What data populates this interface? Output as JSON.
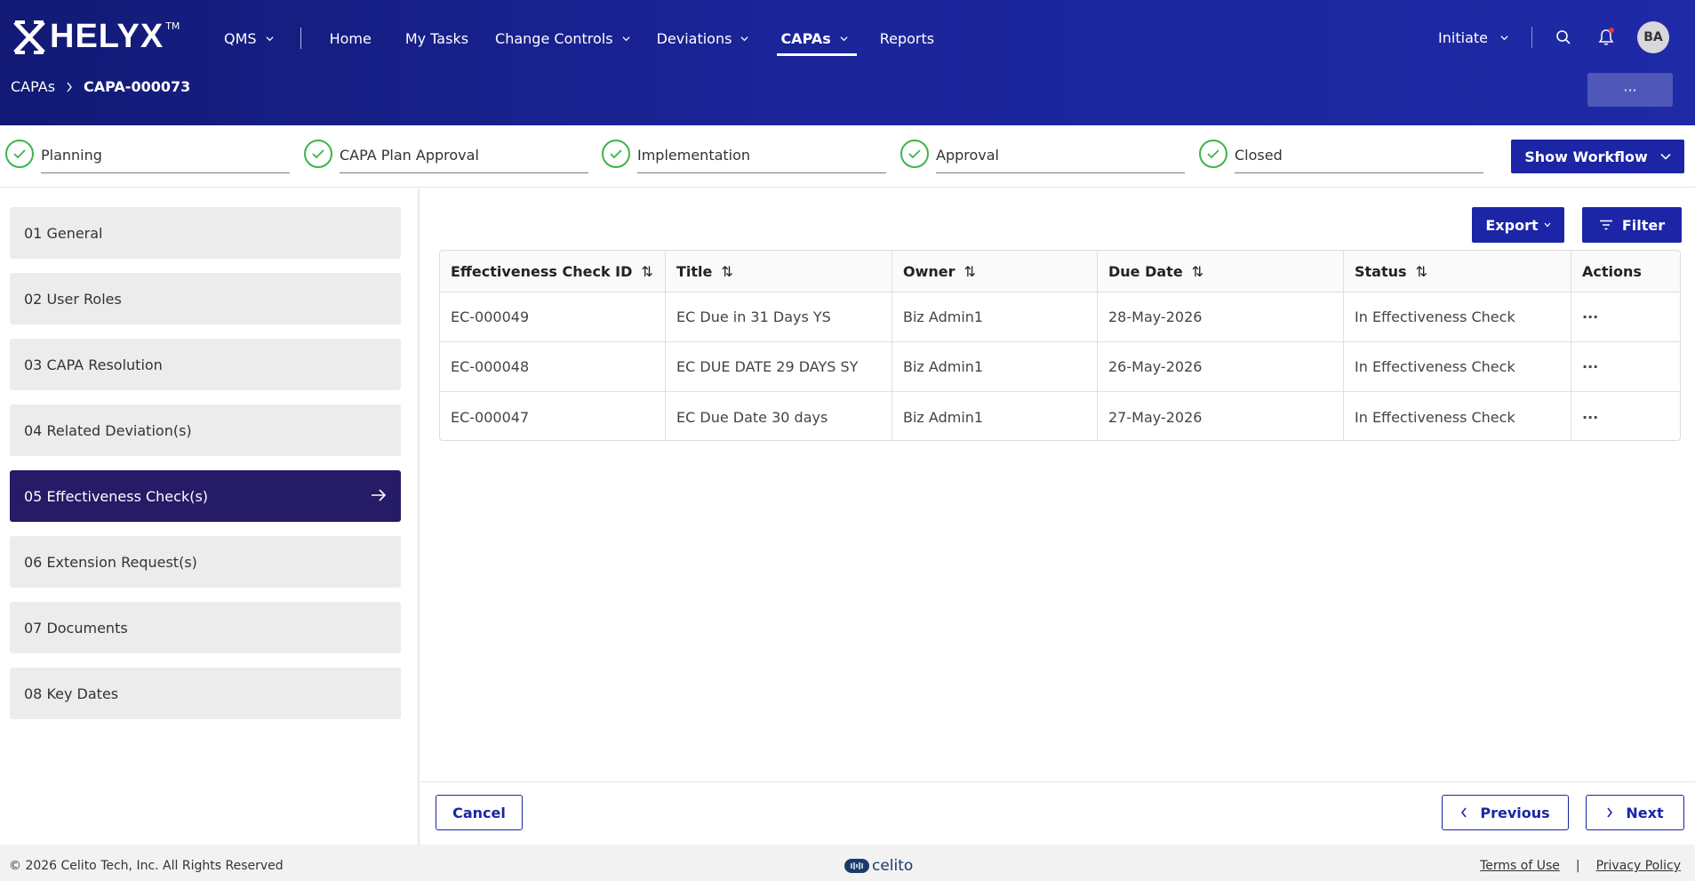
{
  "app": {
    "logo_text": "HELYX",
    "logo_tm": "TM"
  },
  "nav": {
    "items": [
      {
        "label": "QMS",
        "dropdown": true
      },
      {
        "label": "Home",
        "dropdown": false
      },
      {
        "label": "My Tasks",
        "dropdown": false
      },
      {
        "label": "Change Controls",
        "dropdown": true
      },
      {
        "label": "Deviations",
        "dropdown": true
      },
      {
        "label": "CAPAs",
        "dropdown": true,
        "active": true
      },
      {
        "label": "Reports",
        "dropdown": false
      }
    ],
    "initiate_label": "Initiate",
    "avatar_initials": "BA"
  },
  "breadcrumb": {
    "parent": "CAPAs",
    "current": "CAPA-000073"
  },
  "more_button_label": "···",
  "workflow": {
    "steps": [
      "Planning",
      "CAPA Plan Approval",
      "Implementation",
      "Approval",
      "Closed"
    ],
    "show_workflow_label": "Show Workflow"
  },
  "sidebar": {
    "items": [
      "01 General",
      "02 User Roles",
      "03 CAPA Resolution",
      "04 Related Deviation(s)",
      "05 Effectiveness Check(s)",
      "06 Extension Request(s)",
      "07 Documents",
      "08 Key Dates"
    ],
    "active_index": 4
  },
  "toolbar": {
    "export_label": "Export",
    "filter_label": "Filter"
  },
  "table": {
    "columns": [
      "Effectiveness Check ID",
      "Title",
      "Owner",
      "Due Date",
      "Status",
      "Actions"
    ],
    "rows": [
      {
        "id": "EC-000049",
        "title": "EC Due in 31 Days YS",
        "owner": "Biz Admin1",
        "due": "28-May-2026",
        "status": "In Effectiveness Check",
        "actions": "···"
      },
      {
        "id": "EC-000048",
        "title": "EC DUE DATE 29 DAYS SY",
        "owner": "Biz Admin1",
        "due": "26-May-2026",
        "status": "In Effectiveness Check",
        "actions": "···"
      },
      {
        "id": "EC-000047",
        "title": "EC Due Date 30 days",
        "owner": "Biz Admin1",
        "due": "27-May-2026",
        "status": "In Effectiveness Check",
        "actions": "···"
      }
    ]
  },
  "footer_actions": {
    "cancel_label": "Cancel",
    "previous_label": "Previous",
    "next_label": "Next"
  },
  "page_footer": {
    "copyright": "© 2026 Celito Tech, Inc. All Rights Reserved",
    "brand": "celito",
    "terms_label": "Terms of Use",
    "separator": "|",
    "privacy_label": "Privacy Policy"
  },
  "colors": {
    "primary": "#1b25a5",
    "header_dark": "#121a75",
    "active_side": "#251b66",
    "success": "#3bb54a"
  }
}
